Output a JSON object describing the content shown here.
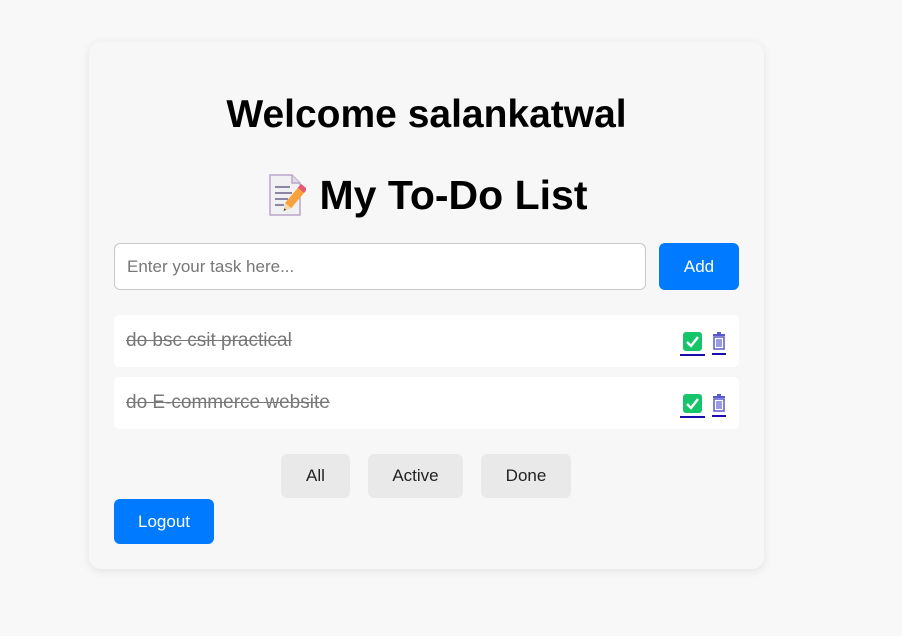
{
  "header": {
    "welcome_text": "Welcome salankatwal",
    "list_title": "My To-Do List",
    "title_icon": "memo-icon"
  },
  "new_task": {
    "placeholder": "Enter your task here...",
    "value": "",
    "add_label": "Add"
  },
  "tasks": [
    {
      "text": "do bsc csit practical",
      "completed": true
    },
    {
      "text": "do E-commerce website",
      "completed": true
    }
  ],
  "task_actions": {
    "complete_icon": "check-icon",
    "delete_icon": "trash-icon"
  },
  "filters": {
    "all": "All",
    "active": "Active",
    "done": "Done"
  },
  "logout_label": "Logout",
  "colors": {
    "primary": "#007bff",
    "check": "#16c56a",
    "completed_text": "#777777",
    "link": "#1a0dab"
  }
}
